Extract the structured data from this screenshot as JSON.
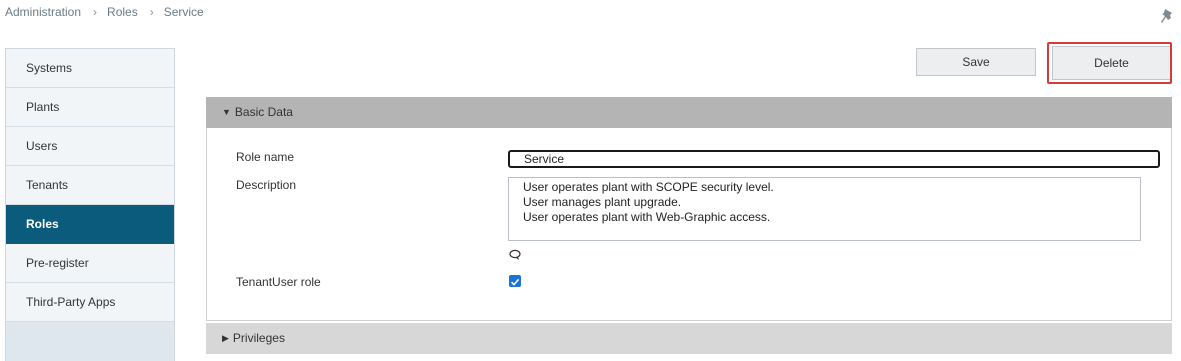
{
  "breadcrumb": [
    "Administration",
    "Roles",
    "Service"
  ],
  "breadcrumb_separator": "›",
  "sidebar": {
    "items": [
      {
        "label": "Systems",
        "active": false
      },
      {
        "label": "Plants",
        "active": false
      },
      {
        "label": "Users",
        "active": false
      },
      {
        "label": "Tenants",
        "active": false
      },
      {
        "label": "Roles",
        "active": true
      },
      {
        "label": "Pre-register",
        "active": false
      },
      {
        "label": "Third-Party Apps",
        "active": false
      }
    ]
  },
  "toolbar": {
    "save_label": "Save",
    "delete_label": "Delete"
  },
  "basic_data": {
    "header": "Basic Data",
    "role_name_label": "Role name",
    "role_name_value": "Service",
    "description_label": "Description",
    "description_lines": [
      "User operates plant with SCOPE security level.",
      "User manages plant upgrade.",
      "User operates plant with Web-Graphic access."
    ],
    "tenant_user_label": "TenantUser role",
    "tenant_user_checked": true
  },
  "privileges": {
    "header": "Privileges"
  },
  "colors": {
    "active_nav": "#0b5b7d",
    "sidebar_bg": "#dfe7ee",
    "basic_header": "#b4b4b4",
    "priv_header": "#d7d7d7",
    "checkbox": "#1b73d3",
    "highlight": "#d83a3a"
  },
  "icons": {
    "pin": "pin-icon",
    "comment": "comment-icon",
    "expand": "triangle-down-icon",
    "collapse": "triangle-right-icon"
  }
}
